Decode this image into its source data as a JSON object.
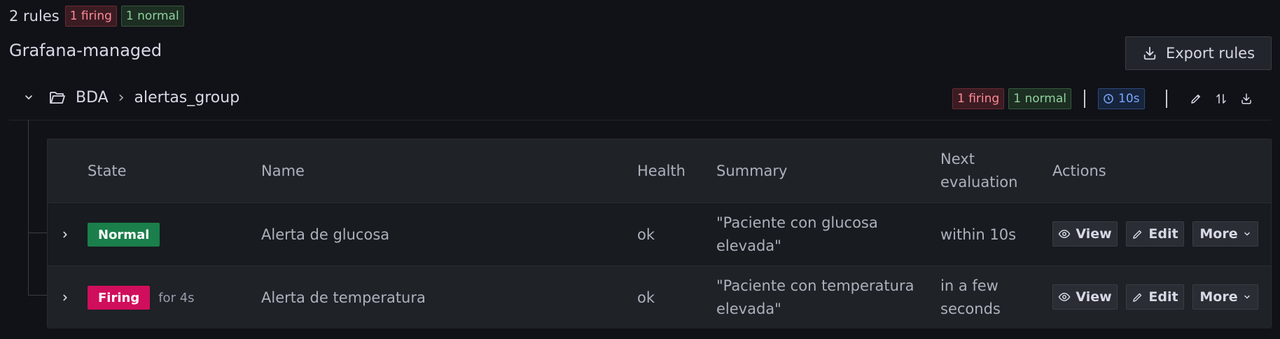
{
  "summary": {
    "rule_count": "2 rules",
    "firing_badge": "1 firing",
    "normal_badge": "1 normal"
  },
  "section": {
    "title": "Grafana-managed",
    "export_label": "Export rules"
  },
  "group": {
    "folder": "BDA",
    "separator": "›",
    "name": "alertas_group",
    "firing_badge": "1 firing",
    "normal_badge": "1 normal",
    "interval": "10s"
  },
  "table": {
    "headers": {
      "state": "State",
      "name": "Name",
      "health": "Health",
      "summary": "Summary",
      "next_eval_line1": "Next",
      "next_eval_line2": "evaluation",
      "actions": "Actions"
    },
    "rows": [
      {
        "state": "Normal",
        "for": "",
        "name": "Alerta de glucosa",
        "health": "ok",
        "summary_line1": "\"Paciente con glucosa",
        "summary_line2": "elevada\"",
        "next_line1": "within 10s",
        "next_line2": ""
      },
      {
        "state": "Firing",
        "for": "for 4s",
        "name": "Alerta de temperatura",
        "health": "ok",
        "summary_line1": "\"Paciente con temperatura",
        "summary_line2": "elevada\"",
        "next_line1": "in a few",
        "next_line2": "seconds"
      }
    ],
    "action_labels": {
      "view": "View",
      "edit": "Edit",
      "more": "More"
    }
  },
  "colors": {
    "background": "#111217",
    "firing": "#d10e5c",
    "normal": "#1a7f4b",
    "interval": "#7aa7ff"
  },
  "icons": [
    "chevron-down-icon",
    "folder-open-icon",
    "chevron-right-icon",
    "clock-icon",
    "pencil-icon",
    "sort-icon",
    "download-icon",
    "eye-icon",
    "chevron-down-small-icon"
  ]
}
